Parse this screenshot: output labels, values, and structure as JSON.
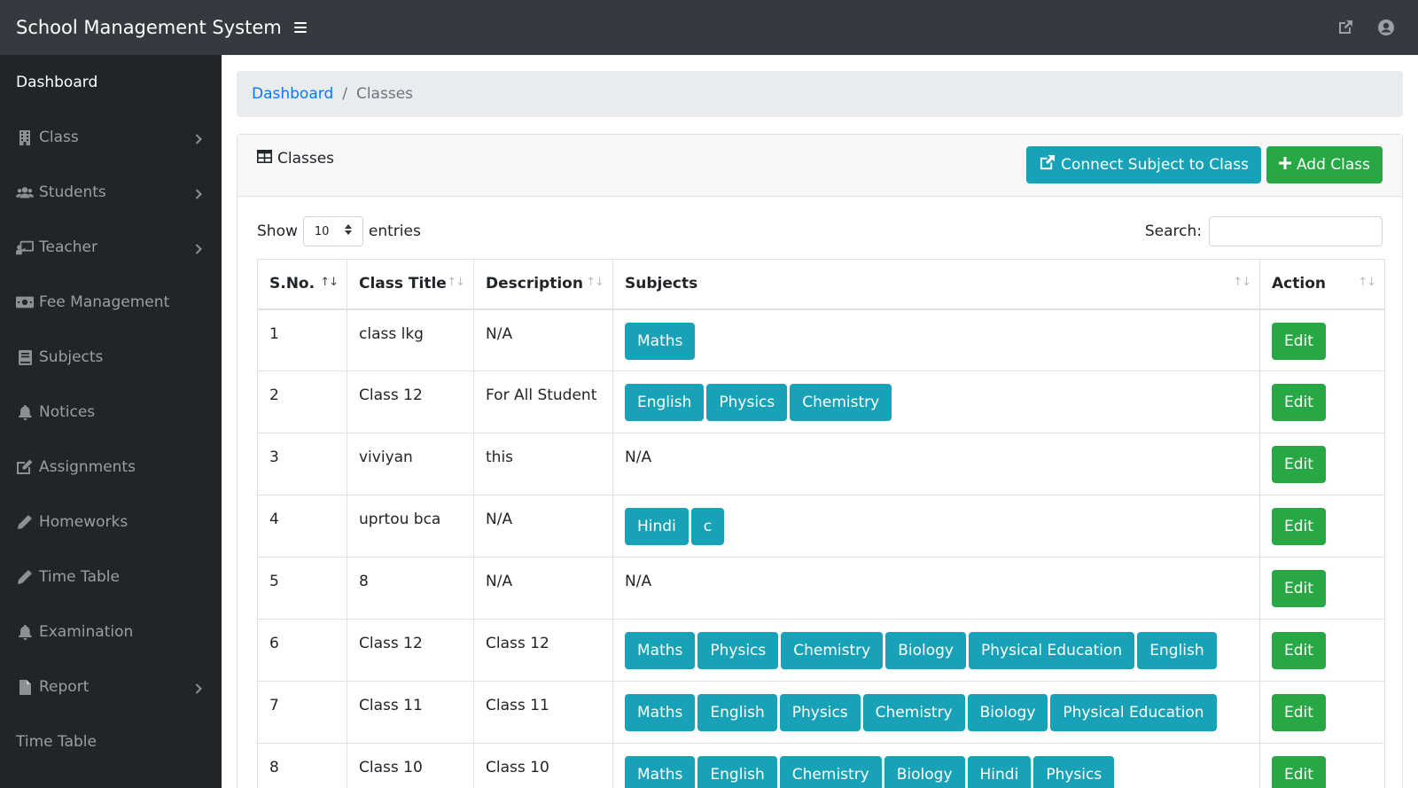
{
  "app": {
    "title": "School Management System"
  },
  "topbar": {
    "icons": [
      "external-link-icon",
      "user-circle-icon"
    ]
  },
  "sidebar": {
    "items": [
      {
        "label": "Dashboard",
        "icon": "",
        "chevron": false,
        "active": true
      },
      {
        "label": "Class",
        "icon": "building-icon",
        "chevron": true
      },
      {
        "label": "Students",
        "icon": "users-icon",
        "chevron": true
      },
      {
        "label": "Teacher",
        "icon": "chalkboard-teacher-icon",
        "chevron": true
      },
      {
        "label": "Fee Management",
        "icon": "money-bill-icon",
        "chevron": false
      },
      {
        "label": "Subjects",
        "icon": "book-icon",
        "chevron": false
      },
      {
        "label": "Notices",
        "icon": "bell-icon",
        "chevron": false
      },
      {
        "label": "Assignments",
        "icon": "edit-icon",
        "chevron": false
      },
      {
        "label": "Homeworks",
        "icon": "pencil-icon",
        "chevron": false
      },
      {
        "label": "Time Table",
        "icon": "pencil-icon",
        "chevron": false
      },
      {
        "label": "Examination",
        "icon": "bell-icon",
        "chevron": false
      },
      {
        "label": "Report",
        "icon": "file-icon",
        "chevron": true
      },
      {
        "label": "Time Table",
        "icon": "",
        "chevron": false
      }
    ]
  },
  "breadcrumb": {
    "home": "Dashboard",
    "separator": "/",
    "current": "Classes"
  },
  "card": {
    "title": "Classes",
    "connect_label": "Connect Subject to Class",
    "add_label": "Add Class"
  },
  "controls": {
    "show_label": "Show",
    "entries_value": "10",
    "entries_label": "entries",
    "search_label": "Search:",
    "search_value": ""
  },
  "table": {
    "headers": [
      "S.No.",
      "Class Title",
      "Description",
      "Subjects",
      "Action"
    ],
    "edit_label": "Edit",
    "rows": [
      {
        "sno": "1",
        "title": "class lkg",
        "description": "N/A",
        "subjects": [
          "Maths"
        ]
      },
      {
        "sno": "2",
        "title": "Class 12",
        "description": "For All Student",
        "subjects": [
          "English",
          "Physics",
          "Chemistry"
        ]
      },
      {
        "sno": "3",
        "title": "viviyan",
        "description": "this",
        "subjects": [],
        "subjects_text": "N/A"
      },
      {
        "sno": "4",
        "title": "uprtou bca",
        "description": "N/A",
        "subjects": [
          "Hindi",
          "c"
        ]
      },
      {
        "sno": "5",
        "title": "8",
        "description": "N/A",
        "subjects": [],
        "subjects_text": "N/A"
      },
      {
        "sno": "6",
        "title": "Class 12",
        "description": "Class 12",
        "subjects": [
          "Maths",
          "Physics",
          "Chemistry",
          "Biology",
          "Physical Education",
          "English"
        ]
      },
      {
        "sno": "7",
        "title": "Class 11",
        "description": "Class 11",
        "subjects": [
          "Maths",
          "English",
          "Physics",
          "Chemistry",
          "Biology",
          "Physical Education"
        ]
      },
      {
        "sno": "8",
        "title": "Class 10",
        "description": "Class 10",
        "subjects": [
          "Maths",
          "English",
          "Chemistry",
          "Biology",
          "Hindi",
          "Physics"
        ]
      }
    ]
  },
  "colors": {
    "navbar": "#343a40",
    "sidebar": "#212529",
    "info": "#17a2b8",
    "success": "#28a745",
    "link": "#007bff"
  }
}
